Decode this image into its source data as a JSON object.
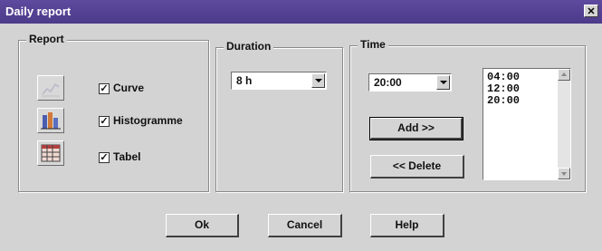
{
  "window": {
    "title": "Daily report",
    "close_glyph": "✕"
  },
  "report": {
    "label": "Report",
    "options": [
      {
        "icon": "curve-icon",
        "label": "Curve",
        "checked": true
      },
      {
        "icon": "histogram-icon",
        "label": "Histogramme",
        "checked": true
      },
      {
        "icon": "table-icon",
        "label": "Tabel",
        "checked": true
      }
    ],
    "check_glyph": "✓"
  },
  "duration": {
    "label": "Duration",
    "value": "8 h"
  },
  "time": {
    "label": "Time",
    "value": "20:00",
    "add_label": "Add >>",
    "delete_label": "<< Delete",
    "list": [
      "04:00",
      "12:00",
      "20:00"
    ]
  },
  "footer": {
    "ok_label": "Ok",
    "cancel_label": "Cancel",
    "help_label": "Help"
  }
}
